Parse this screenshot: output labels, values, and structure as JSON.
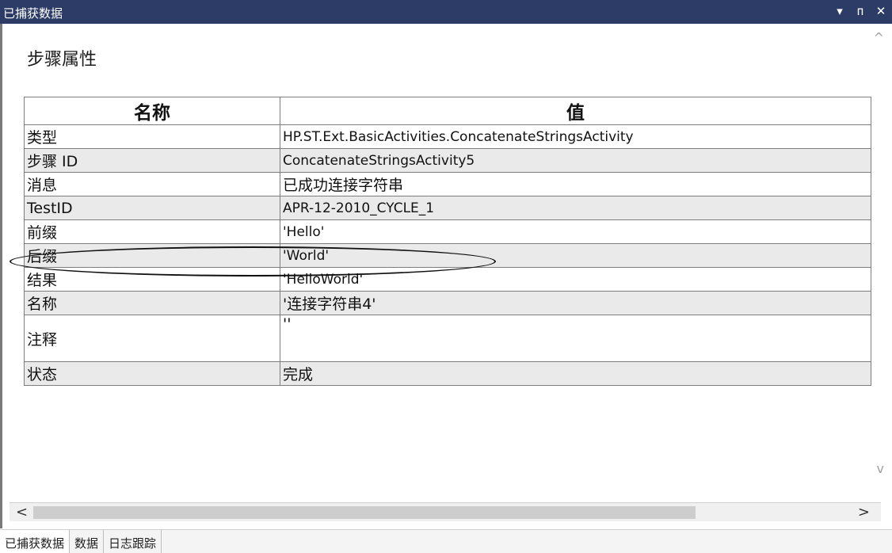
{
  "titlebar": {
    "title": "已捕获数据",
    "dropdown": "▾",
    "pin": "ᴨ",
    "close": "✕"
  },
  "section_title": "步骤属性",
  "table": {
    "headers": [
      "名称",
      "值"
    ],
    "rows": [
      {
        "name": "类型",
        "value": "HP.ST.Ext.BasicActivities.ConcatenateStringsActivity"
      },
      {
        "name": "步骤 ID",
        "value": "ConcatenateStringsActivity5"
      },
      {
        "name": "消息",
        "value": "已成功连接字符串"
      },
      {
        "name": "TestID",
        "value": "APR-12-2010_CYCLE_1"
      },
      {
        "name": "前缀",
        "value": "'Hello'"
      },
      {
        "name": "后缀",
        "value": "'World'"
      },
      {
        "name": "结果",
        "value": "'HelloWorld'"
      },
      {
        "name": "名称",
        "value": "'连接字符串4'"
      },
      {
        "name": "注释",
        "value": "''"
      },
      {
        "name": "状态",
        "value": "完成"
      }
    ]
  },
  "scroll": {
    "up": "^",
    "down": "v",
    "left": "<",
    "right": ">"
  },
  "tabs": [
    "已捕获数据",
    "数据",
    "日志跟踪"
  ]
}
